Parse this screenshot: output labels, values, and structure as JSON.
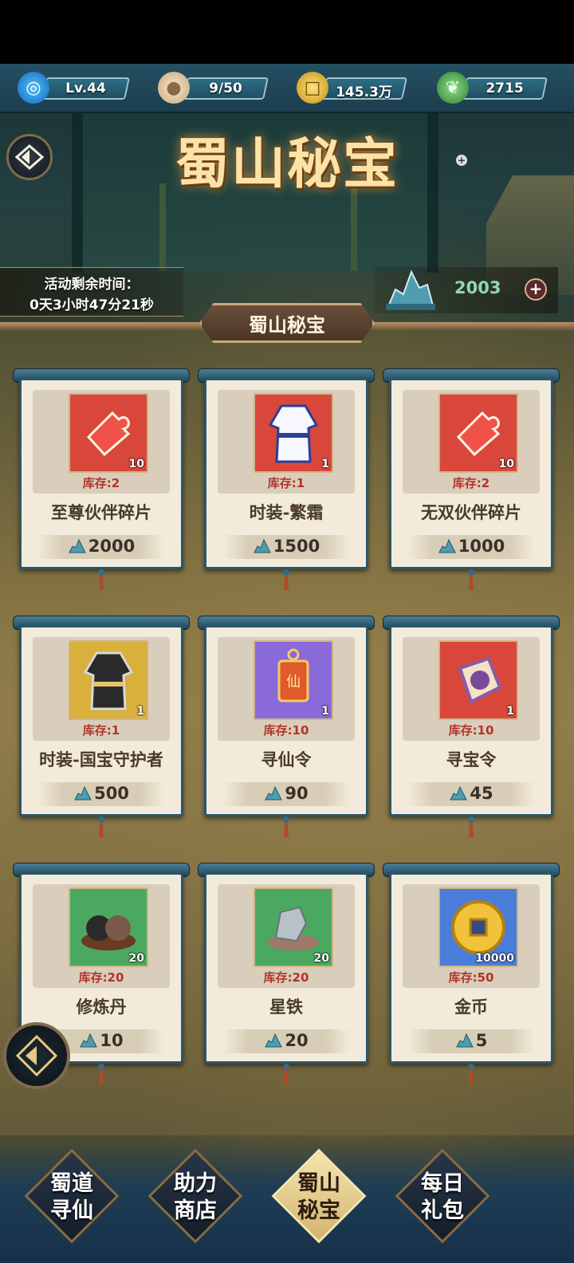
{
  "resources": [
    {
      "name": "level",
      "value": "Lv.44",
      "icon": "swirl-icon"
    },
    {
      "name": "bun",
      "value": "9/50",
      "icon": "steamed-bun-icon"
    },
    {
      "name": "coin",
      "value": "145.3万",
      "icon": "gold-coin-icon"
    },
    {
      "name": "leaf",
      "value": "2715",
      "icon": "jade-leaf-icon"
    }
  ],
  "banner": {
    "title": "蜀山秘宝",
    "timer_label": "活动剩余时间：",
    "timer_value": "0天3小时47分21秒",
    "jade_count": "2003",
    "jade_plus": "+"
  },
  "section_title": "蜀山秘宝",
  "items": [
    {
      "name": "至尊伙伴碎片",
      "stock": "库存:2",
      "qty": "10",
      "price": "2000",
      "bg": "#d9473b",
      "icon": "puzzle-piece-icon"
    },
    {
      "name": "时装-繁霜",
      "stock": "库存:1",
      "qty": "1",
      "price": "1500",
      "bg": "#d9473b",
      "icon": "white-robe-icon"
    },
    {
      "name": "无双伙伴碎片",
      "stock": "库存:2",
      "qty": "10",
      "price": "1000",
      "bg": "#d9473b",
      "icon": "puzzle-piece-icon"
    },
    {
      "name": "时装-国宝守护者",
      "stock": "库存:1",
      "qty": "1",
      "price": "500",
      "bg": "#d9b03b",
      "icon": "black-robe-icon"
    },
    {
      "name": "寻仙令",
      "stock": "库存:10",
      "qty": "1",
      "price": "90",
      "bg": "#8a6ad8",
      "icon": "token-icon"
    },
    {
      "name": "寻宝令",
      "stock": "库存:10",
      "qty": "1",
      "price": "45",
      "bg": "#d9473b",
      "icon": "treasure-map-icon"
    },
    {
      "name": "修炼丹",
      "stock": "库存:20",
      "qty": "20",
      "price": "10",
      "bg": "#4aa860",
      "icon": "pill-icon"
    },
    {
      "name": "星铁",
      "stock": "库存:20",
      "qty": "20",
      "price": "20",
      "bg": "#4aa860",
      "icon": "ore-icon"
    },
    {
      "name": "金币",
      "stock": "库存:50",
      "qty": "10000",
      "price": "5",
      "bg": "#4a7dd8",
      "icon": "gold-coin-icon"
    }
  ],
  "nav": [
    {
      "label1": "蜀道",
      "label2": "寻仙"
    },
    {
      "label1": "助力",
      "label2": "商店"
    },
    {
      "label1": "蜀山",
      "label2": "秘宝"
    },
    {
      "label1": "每日",
      "label2": "礼包"
    }
  ]
}
